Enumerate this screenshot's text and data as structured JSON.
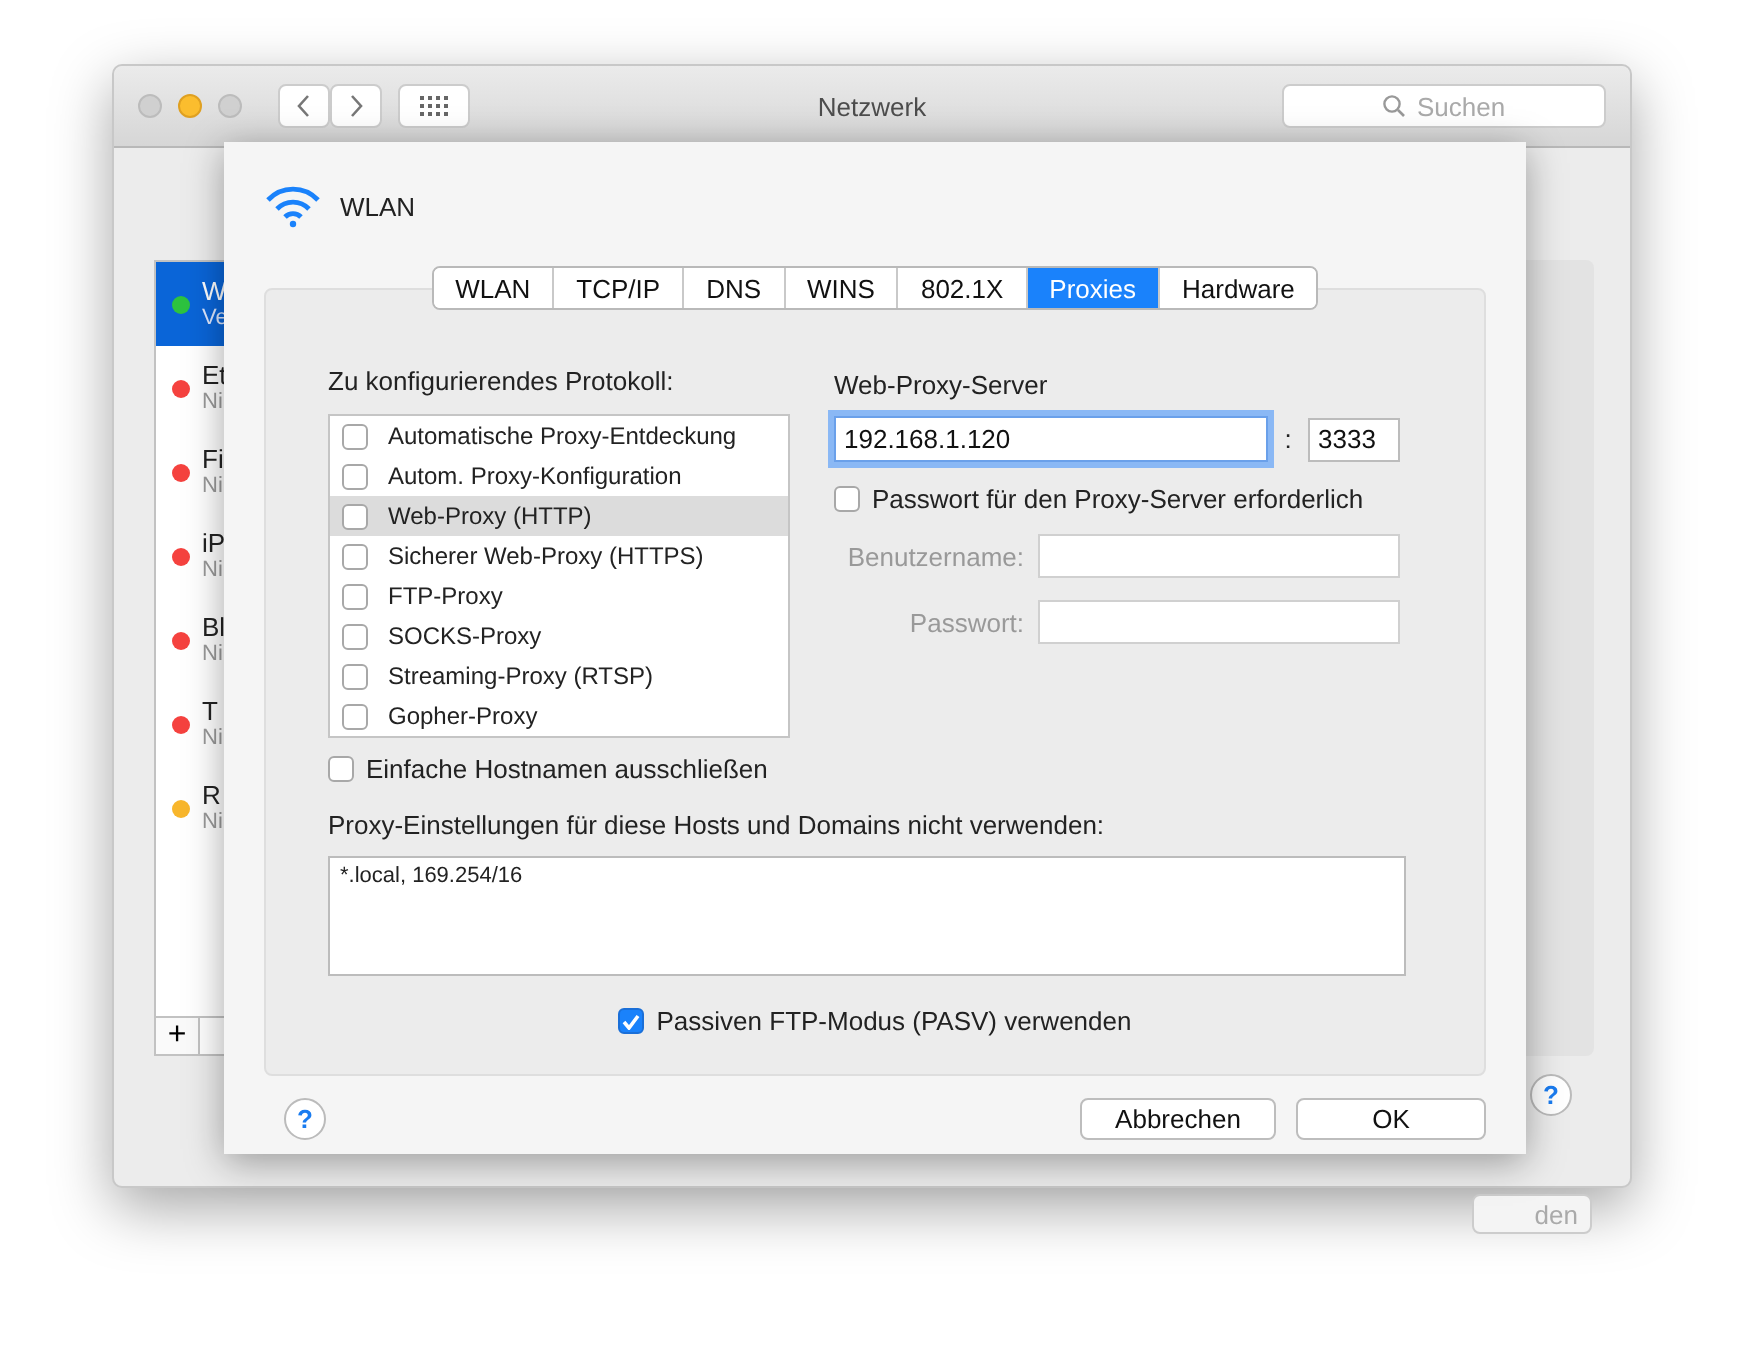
{
  "window": {
    "title": "Netzwerk",
    "search": {
      "placeholder": "Suchen"
    }
  },
  "sidebar": {
    "items": [
      {
        "name": "W",
        "status": "Ve",
        "color": "#2dc33f",
        "selected": true
      },
      {
        "name": "Et",
        "status": "Ni",
        "color": "#f5423f",
        "selected": false
      },
      {
        "name": "Fi",
        "status": "Ni",
        "color": "#f5423f",
        "selected": false
      },
      {
        "name": "iP",
        "status": "Ni",
        "color": "#f5423f",
        "selected": false
      },
      {
        "name": "Bl",
        "status": "Ni",
        "color": "#f5423f",
        "selected": false
      },
      {
        "name": "T",
        "status": "Ni",
        "color": "#f5423f",
        "selected": false
      },
      {
        "name": "R",
        "status": "Ni",
        "color": "#f8b62c",
        "selected": false
      }
    ],
    "add_button": "+"
  },
  "help_button": "?",
  "apply_button": "den",
  "sheet": {
    "title": "WLAN",
    "tabs": [
      {
        "label": "WLAN",
        "selected": false
      },
      {
        "label": "TCP/IP",
        "selected": false
      },
      {
        "label": "DNS",
        "selected": false
      },
      {
        "label": "WINS",
        "selected": false
      },
      {
        "label": "802.1X",
        "selected": false
      },
      {
        "label": "Proxies",
        "selected": true
      },
      {
        "label": "Hardware",
        "selected": false
      }
    ],
    "protocol_label": "Zu konfigurierendes Protokoll:",
    "protocols": [
      {
        "label": "Automatische Proxy-Entdeckung",
        "checked": false,
        "selected": false
      },
      {
        "label": "Autom. Proxy-Konfiguration",
        "checked": false,
        "selected": false
      },
      {
        "label": "Web-Proxy (HTTP)",
        "checked": false,
        "selected": true
      },
      {
        "label": "Sicherer Web-Proxy (HTTPS)",
        "checked": false,
        "selected": false
      },
      {
        "label": "FTP-Proxy",
        "checked": false,
        "selected": false
      },
      {
        "label": "SOCKS-Proxy",
        "checked": false,
        "selected": false
      },
      {
        "label": "Streaming-Proxy (RTSP)",
        "checked": false,
        "selected": false
      },
      {
        "label": "Gopher-Proxy",
        "checked": false,
        "selected": false
      }
    ],
    "exclude_simple_hostnames": {
      "label": "Einfache Hostnamen ausschließen",
      "checked": false
    },
    "server_label": "Web-Proxy-Server",
    "server": "192.168.1.120",
    "separator": ":",
    "port": "3333",
    "password_required": {
      "label": "Passwort für den Proxy-Server erforderlich",
      "checked": false
    },
    "username_label": "Benutzername:",
    "password_label": "Passwort:",
    "bypass_label": "Proxy-Einstellungen für diese Hosts und Domains nicht verwenden:",
    "bypass": "*.local, 169.254/16",
    "passive_ftp": {
      "label": "Passiven FTP-Modus (PASV) verwenden",
      "checked": true
    },
    "help_button": "?",
    "buttons": [
      "Abbrechen",
      "OK"
    ]
  }
}
